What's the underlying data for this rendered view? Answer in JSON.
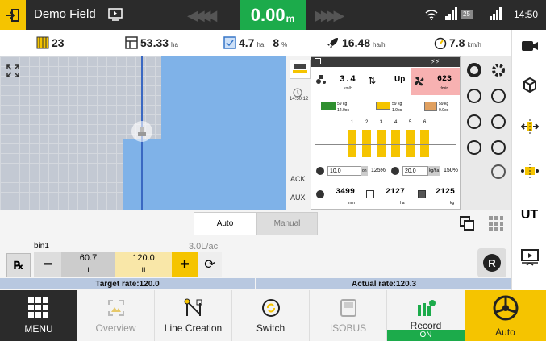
{
  "topbar": {
    "field_name": "Demo Field",
    "speed_value": "0.00",
    "speed_unit": "m",
    "clock": "14:50",
    "signal_badge": "25"
  },
  "stats": {
    "swaths": "23",
    "area": "53.33",
    "area_unit": "ha",
    "worked": "4.7",
    "worked_unit": "ha",
    "percent": "8",
    "percent_unit": "%",
    "rate": "16.48",
    "rate_unit": "ha/h",
    "avg_speed": "7.8",
    "avg_speed_unit": "km/h"
  },
  "iso": {
    "time": "14:50:12",
    "speed": "3.4",
    "speed_unit": "km/h",
    "updown": "Up",
    "fan": "623",
    "fan_unit": "r/min",
    "tank1": "59",
    "tank1_unit": "kg",
    "tank1_sub": "12.0oc",
    "tank2": "59",
    "tank2_unit": "kg",
    "tank2_sub": "1.0oc",
    "tank3": "59",
    "tank3_unit": "kg",
    "tank3_sub": "0.0oc",
    "sections": [
      "1",
      "2",
      "3",
      "4",
      "5",
      "6"
    ],
    "left_rate": "10.0",
    "left_rate_unit": "oh",
    "left_pct": "125%",
    "right_rate": "20.0",
    "right_rate_unit": "kg/ha",
    "right_pct": "150%",
    "ack": "ACK",
    "aux": "AUX",
    "count1": "3499",
    "count1_unit": "min",
    "count2": "2127",
    "count2_unit": "ha",
    "count3": "2125",
    "count3_unit": "kg"
  },
  "control": {
    "mode_auto": "Auto",
    "mode_manual": "Manual",
    "bin_name": "bin1",
    "rate_display": "3.0L/ac",
    "value_left": "60.7",
    "value_left_label": "I",
    "value_right": "120.0",
    "value_right_label": "II"
  },
  "status": {
    "target": "Target rate:120.0",
    "actual": "Actual rate:120.3"
  },
  "nav": {
    "menu": "MENU",
    "overview": "Overview",
    "line_creation": "Line Creation",
    "switch": "Switch",
    "isobus": "ISOBUS",
    "record": "Record",
    "record_state": "ON",
    "auto": "Auto"
  },
  "colors": {
    "accent": "#f5c400",
    "speed_green": "#1cab4b",
    "map_field": "#a4c5ea",
    "coverage": "#7fb2e8"
  }
}
